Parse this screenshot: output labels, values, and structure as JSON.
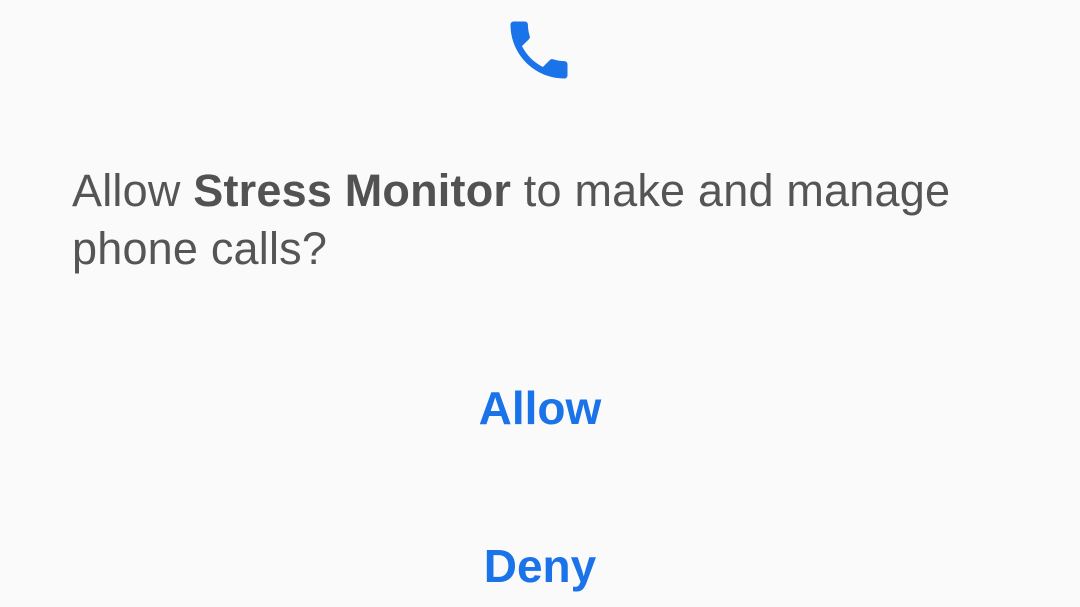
{
  "dialog": {
    "icon": "phone-icon",
    "accent_color": "#1a73e8",
    "message_prefix": "Allow ",
    "app_name": "Stress Monitor",
    "message_suffix": " to make and manage phone calls?",
    "allow_label": "Allow",
    "deny_label": "Deny"
  }
}
